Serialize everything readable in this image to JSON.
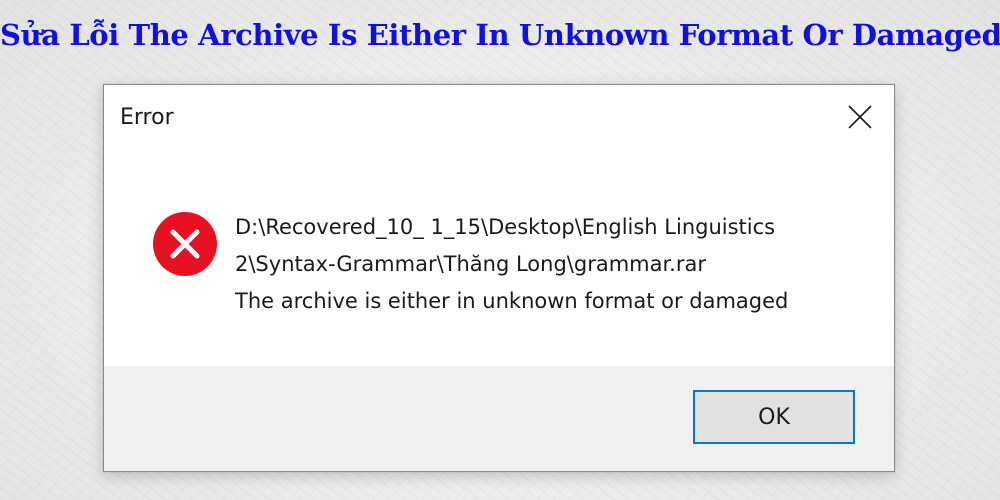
{
  "page": {
    "headline": "Sửa Lỗi The Archive Is Either In Unknown Format Or Damaged",
    "headline_color": "#1010e6"
  },
  "dialog": {
    "title": "Error",
    "close_icon": "close-icon",
    "status_icon": "error-icon",
    "status_icon_color": "#e81123",
    "message_lines": [
      "D:\\Recovered_10_ 1_15\\Desktop\\English Linguistics",
      "2\\Syntax-Grammar\\Thăng Long\\grammar.rar",
      "The archive is either in unknown format or damaged"
    ],
    "ok_label": "OK",
    "accent_color": "#0078d7"
  }
}
